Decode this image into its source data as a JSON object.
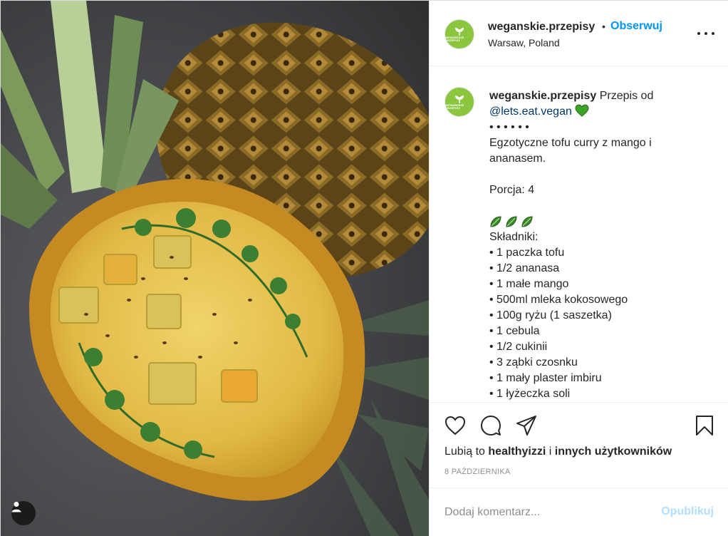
{
  "post": {
    "photo_alt": "",
    "user_tag_icon": "person-icon"
  },
  "header": {
    "username": "weganskie.przepisy",
    "dot": "•",
    "follow_label": "Obserwuj",
    "location": "Warsaw, Poland",
    "avatar_brand": "WEGAŃSKIE PRZEPISY",
    "avatar_color": "#8cc63f"
  },
  "caption": {
    "username": "weganskie.przepisy",
    "intro": " Przepis od",
    "mention": "@lets.eat.vegan",
    "heart_color": "#3ea12a",
    "dots": "• • • • • •",
    "title_line1": "Egzotyczne tofu curry z mango i",
    "title_line2": "ananasem.",
    "servings": "Porcja: 4",
    "ingredients_heading": "Składniki:",
    "ingredients": [
      "• 1 paczka tofu",
      "• 1/2 ananasa",
      "• 1 małe mango",
      "• 500ml mleka kokosowego",
      "• 100g ryżu (1 saszetka)",
      "• 1 cebula",
      "• 1/2 cukinii",
      "• 3 ząbki czosnku",
      "• 1 mały plaster imbiru",
      "• 1 łyżeczka soli"
    ]
  },
  "actions": {
    "likes_prefix": "Lubią to ",
    "likes_user": "healthyizzi",
    "likes_mid": " i ",
    "likes_others": "innych użytkowników",
    "date": "8 PAŹDZIERNIKA"
  },
  "comment": {
    "placeholder": "Dodaj komentarz...",
    "publish_label": "Opublikuj"
  },
  "colors": {
    "follow": "#0095f6",
    "publish_disabled": "#b2dffc",
    "secondary_text": "#8e8e8e",
    "border": "#efefef"
  }
}
